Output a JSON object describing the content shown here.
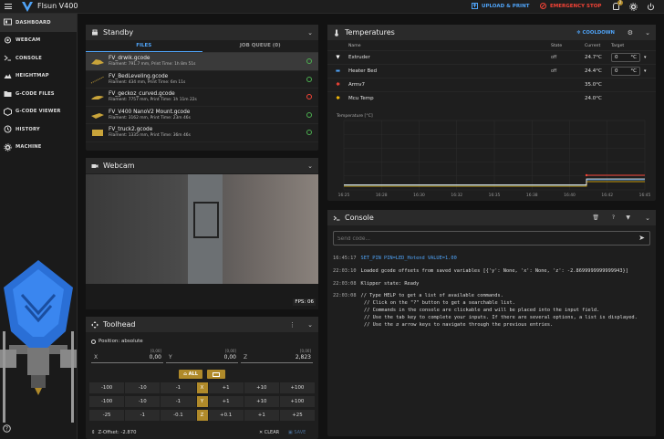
{
  "topbar": {
    "title": "Flsun V400",
    "upload_label": "UPLOAD & PRINT",
    "emergency_label": "EMERGENCY STOP",
    "notif_count": "2"
  },
  "sidebar": {
    "items": [
      {
        "label": "DASHBOARD",
        "icon": "dashboard-icon"
      },
      {
        "label": "WEBCAM",
        "icon": "webcam-icon"
      },
      {
        "label": "CONSOLE",
        "icon": "console-icon"
      },
      {
        "label": "HEIGHTMAP",
        "icon": "heightmap-icon"
      },
      {
        "label": "G-CODE FILES",
        "icon": "files-icon"
      },
      {
        "label": "G-CODE VIEWER",
        "icon": "viewer-icon"
      },
      {
        "label": "HISTORY",
        "icon": "history-icon"
      },
      {
        "label": "MACHINE",
        "icon": "machine-icon"
      }
    ],
    "help_icon": "help-icon"
  },
  "standby": {
    "title": "Standby",
    "tabs": [
      "FILES",
      "JOB QUEUE (0)"
    ],
    "files": [
      {
        "name": "FV_drwik.gcode",
        "meta": "Filament: 791.7 mm, Print Time: 1h 8m 51s",
        "status": "ok"
      },
      {
        "name": "FV_BedLeveling.gcode",
        "meta": "Filament: 434 mm, Print Time: 6m 11s",
        "status": "ok"
      },
      {
        "name": "FV_geckoz_curved.gcode",
        "meta": "Filament: 7757 mm, Print Time: 1h 11m 22s",
        "status": "error"
      },
      {
        "name": "FV_V400 NanoV2 Mount.gcode",
        "meta": "Filament: 3162 mm, Print Time: 23m 46s",
        "status": "ok"
      },
      {
        "name": "FV_truck2.gcode",
        "meta": "Filament: 1335 mm, Print Time: 36m 46s",
        "status": "ok"
      }
    ]
  },
  "webcam": {
    "title": "Webcam",
    "fps": "FPS: 06"
  },
  "toolhead": {
    "title": "Toolhead",
    "position_label": "Position: absolute",
    "axes": [
      {
        "label": "X",
        "value": "0,00",
        "prev": "[0,00]"
      },
      {
        "label": "Y",
        "value": "0,00",
        "prev": "[0,00]"
      },
      {
        "label": "Z",
        "value": "2,823",
        "prev": "[0,00]"
      }
    ],
    "home_all": "ALL",
    "jog": [
      {
        "axis": "X",
        "neg": [
          "-100",
          "-10",
          "-1"
        ],
        "pos": [
          "+1",
          "+10",
          "+100"
        ]
      },
      {
        "axis": "Y",
        "neg": [
          "-100",
          "-10",
          "-1"
        ],
        "pos": [
          "+1",
          "+10",
          "+100"
        ]
      },
      {
        "axis": "Z",
        "neg": [
          "-25",
          "-1",
          "-0.1"
        ],
        "pos": [
          "+0.1",
          "+1",
          "+25"
        ]
      }
    ],
    "zoffset": "Z-Offset: -2.870",
    "clear": "CLEAR",
    "save": "SAVE"
  },
  "temps": {
    "title": "Temperatures",
    "cooldown": "COOLDOWN",
    "cols": [
      "Name",
      "State",
      "Current",
      "Target"
    ],
    "rows": [
      {
        "name": "Extruder",
        "state": "off",
        "current": "24.7°C",
        "target": "0",
        "unit": "°C",
        "color": "#ffffff"
      },
      {
        "name": "Heater Bed",
        "state": "off",
        "current": "24.4°C",
        "target": "0",
        "unit": "°C",
        "color": "#4fa3f7"
      },
      {
        "name": "Armv7",
        "state": "",
        "current": "35.0°C",
        "target": "",
        "unit": "",
        "color": "#f44336"
      },
      {
        "name": "Mcu Temp",
        "state": "",
        "current": "24.0°C",
        "target": "",
        "unit": "",
        "color": "#ffc107"
      }
    ],
    "chart_ylabel": "Temperature [°C]",
    "chart_x": [
      "16:25",
      "16:28",
      "16:30",
      "16:32",
      "16:35",
      "16:38",
      "16:40",
      "16:42",
      "16:45"
    ]
  },
  "console": {
    "title": "Console",
    "placeholder": "Send code...",
    "lines": [
      {
        "ts": "16:45:17",
        "text": "SET_PIN PIN=LED_Hotend VALUE=1.00",
        "blue": true
      },
      {
        "ts": "22:03:10",
        "text": "Loaded gcode offsets from saved variables [{'y': None, 'x': None, 'z': -2.8699999999999943}]",
        "blue": false
      },
      {
        "ts": "22:03:08",
        "text": "Klipper state: Ready",
        "blue": false
      },
      {
        "ts": "22:03:08",
        "text": "// Type HELP to get a list of available commands.",
        "blue": false
      },
      {
        "ts": "",
        "text": "// Click on the \"?\" button to get a searchable list.",
        "blue": false
      },
      {
        "ts": "",
        "text": "// Commands in the console are clickable and will be placed into the input field.",
        "blue": false
      },
      {
        "ts": "",
        "text": "// Use the tab key to complete your inputs. If there are several options, a list is displayed.",
        "blue": false
      },
      {
        "ts": "",
        "text": "// Use the ⇵ arrow keys to navigate through the previous entries.",
        "blue": false
      }
    ]
  }
}
